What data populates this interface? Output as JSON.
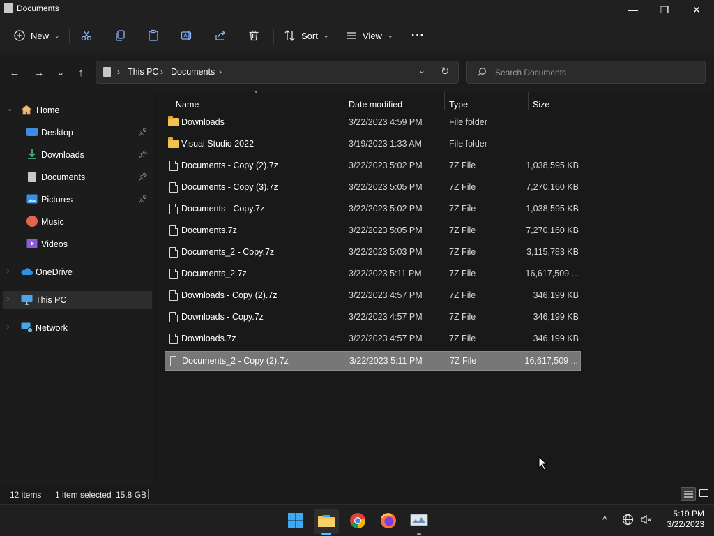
{
  "window": {
    "title": "Documents",
    "controls": {
      "minimize": "—",
      "maximize": "❐",
      "close": "✕"
    }
  },
  "commandbar": {
    "new_label": "New",
    "sort_label": "Sort",
    "view_label": "View",
    "more_label": "···"
  },
  "address": {
    "segments": [
      "This PC",
      "Documents"
    ],
    "separator": "›"
  },
  "search": {
    "placeholder": "Search Documents"
  },
  "sidebar": {
    "home": "Home",
    "quick": [
      {
        "label": "Desktop",
        "icon": "desktop-icon",
        "pinned": true
      },
      {
        "label": "Downloads",
        "icon": "downloads-icon",
        "pinned": true
      },
      {
        "label": "Documents",
        "icon": "documents-icon",
        "pinned": true
      },
      {
        "label": "Pictures",
        "icon": "pictures-icon",
        "pinned": true
      },
      {
        "label": "Music",
        "icon": "music-icon",
        "pinned": false
      },
      {
        "label": "Videos",
        "icon": "videos-icon",
        "pinned": false
      }
    ],
    "onedrive": "OneDrive",
    "thispc": "This PC",
    "network": "Network"
  },
  "columns": {
    "name": "Name",
    "date": "Date modified",
    "type": "Type",
    "size": "Size"
  },
  "files": [
    {
      "name": "Downloads",
      "date": "3/22/2023 4:59 PM",
      "type": "File folder",
      "size": "",
      "kind": "folder"
    },
    {
      "name": "Visual Studio 2022",
      "date": "3/19/2023 1:33 AM",
      "type": "File folder",
      "size": "",
      "kind": "folder"
    },
    {
      "name": "Documents - Copy (2).7z",
      "date": "3/22/2023 5:02 PM",
      "type": "7Z File",
      "size": "1,038,595 KB",
      "kind": "file"
    },
    {
      "name": "Documents - Copy (3).7z",
      "date": "3/22/2023 5:05 PM",
      "type": "7Z File",
      "size": "7,270,160 KB",
      "kind": "file"
    },
    {
      "name": "Documents - Copy.7z",
      "date": "3/22/2023 5:02 PM",
      "type": "7Z File",
      "size": "1,038,595 KB",
      "kind": "file"
    },
    {
      "name": "Documents.7z",
      "date": "3/22/2023 5:05 PM",
      "type": "7Z File",
      "size": "7,270,160 KB",
      "kind": "file"
    },
    {
      "name": "Documents_2 - Copy.7z",
      "date": "3/22/2023 5:03 PM",
      "type": "7Z File",
      "size": "3,115,783 KB",
      "kind": "file"
    },
    {
      "name": "Documents_2.7z",
      "date": "3/22/2023 5:11 PM",
      "type": "7Z File",
      "size": "16,617,509 ...",
      "kind": "file"
    },
    {
      "name": "Downloads - Copy (2).7z",
      "date": "3/22/2023 4:57 PM",
      "type": "7Z File",
      "size": "346,199 KB",
      "kind": "file"
    },
    {
      "name": "Downloads - Copy.7z",
      "date": "3/22/2023 4:57 PM",
      "type": "7Z File",
      "size": "346,199 KB",
      "kind": "file"
    },
    {
      "name": "Downloads.7z",
      "date": "3/22/2023 4:57 PM",
      "type": "7Z File",
      "size": "346,199 KB",
      "kind": "file"
    },
    {
      "name": "Documents_2 - Copy (2).7z",
      "date": "3/22/2023 5:11 PM",
      "type": "7Z File",
      "size": "16,617,509 ...",
      "kind": "file",
      "selected": true
    }
  ],
  "status": {
    "count": "12 items",
    "selection": "1 item selected",
    "size": "15.8 GB"
  },
  "taskbar": {
    "time": "5:19 PM",
    "date": "3/22/2023",
    "apps": [
      "start-icon",
      "file-explorer-icon",
      "chrome-icon",
      "firefox-icon",
      "monitor-app-icon"
    ]
  },
  "colors": {
    "background": "#191919",
    "selection": "#777777",
    "folder": "#f2c14e",
    "accent": "#4cc2ff"
  }
}
